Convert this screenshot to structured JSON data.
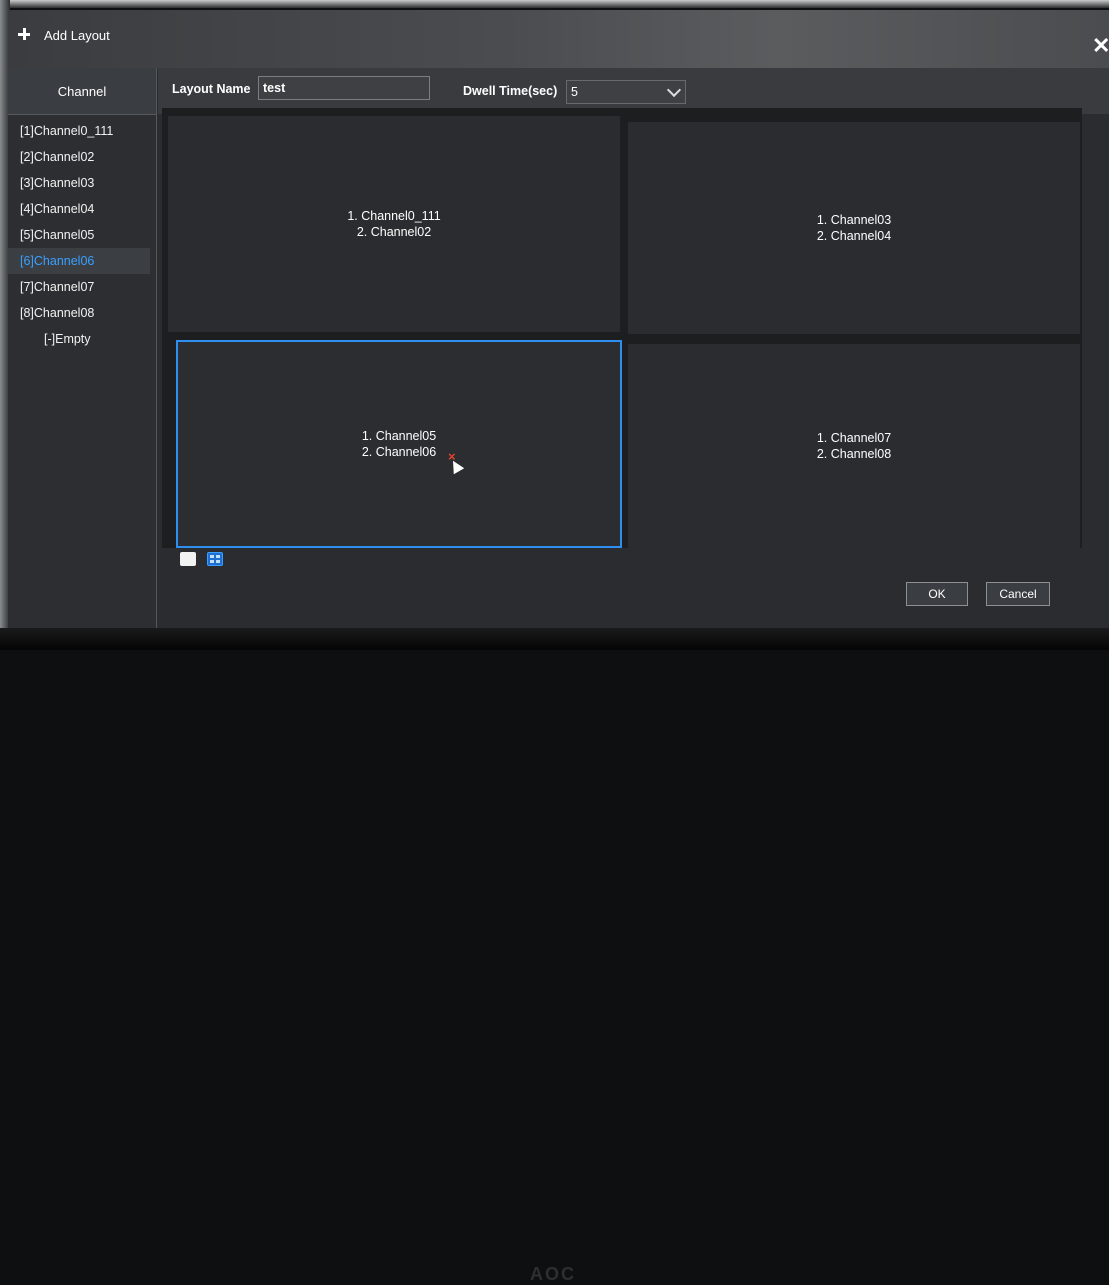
{
  "window": {
    "title": "Add Layout"
  },
  "sidebar": {
    "header": "Channel",
    "items": [
      {
        "label": "[1]Channel0_111"
      },
      {
        "label": "[2]Channel02"
      },
      {
        "label": "[3]Channel03"
      },
      {
        "label": "[4]Channel04"
      },
      {
        "label": "[5]Channel05"
      },
      {
        "label": "[6]Channel06",
        "selected": true
      },
      {
        "label": "[7]Channel07"
      },
      {
        "label": "[8]Channel08"
      },
      {
        "label": "[-]Empty"
      }
    ]
  },
  "form": {
    "layout_name_label": "Layout Name",
    "layout_name_value": "test",
    "dwell_label": "Dwell Time(sec)",
    "dwell_value": "5"
  },
  "grid": {
    "cells": [
      {
        "line1": "1. Channel0_111",
        "line2": "2. Channel02",
        "selected": false
      },
      {
        "line1": "1. Channel03",
        "line2": "2. Channel04",
        "selected": false
      },
      {
        "line1": "1. Channel05",
        "line2": "2. Channel06",
        "selected": true
      },
      {
        "line1": "1. Channel07",
        "line2": "2. Channel08",
        "selected": false
      }
    ],
    "remove_symbol": "×"
  },
  "buttons": {
    "ok": "OK",
    "cancel": "Cancel"
  },
  "monitor": {
    "brand": "AOC"
  },
  "colors": {
    "accent": "#2f8ff0",
    "remove": "#e2422b"
  }
}
